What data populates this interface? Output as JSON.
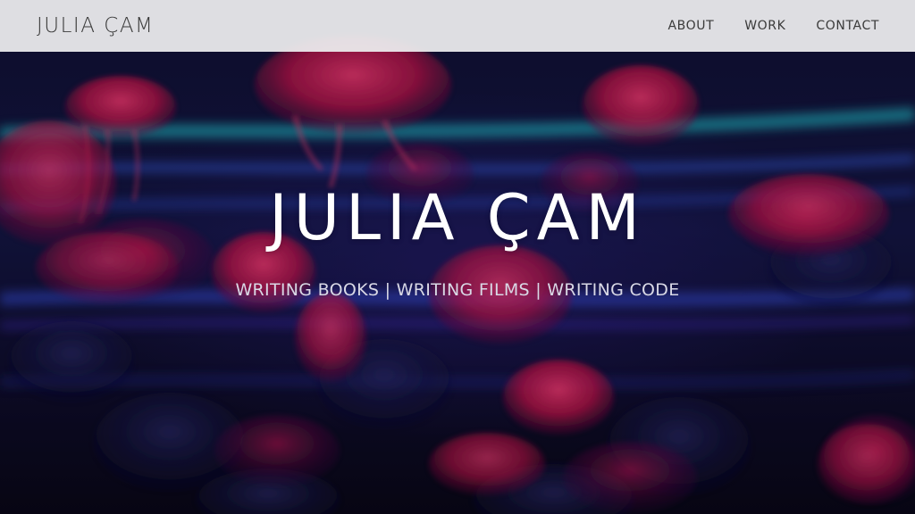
{
  "colors": {
    "nav_background": "#ececee",
    "nav_text": "#3a3a3a",
    "hero_title": "#ffffff",
    "hero_tagline": "#d9d9e6",
    "jellyfish": "#ff1e5a",
    "light_streak_cyan": "#2ad0d8",
    "light_streak_blue": "#3a5cff"
  },
  "nav": {
    "brand": "JULIA ÇAM",
    "links": [
      {
        "label": "ABOUT"
      },
      {
        "label": "WORK"
      },
      {
        "label": "CONTACT"
      }
    ]
  },
  "hero": {
    "background": "jellyfish-aquarium-image",
    "title": "JULIA ÇAM",
    "tagline": "WRITING BOOKS | WRITING FILMS | WRITING CODE"
  }
}
